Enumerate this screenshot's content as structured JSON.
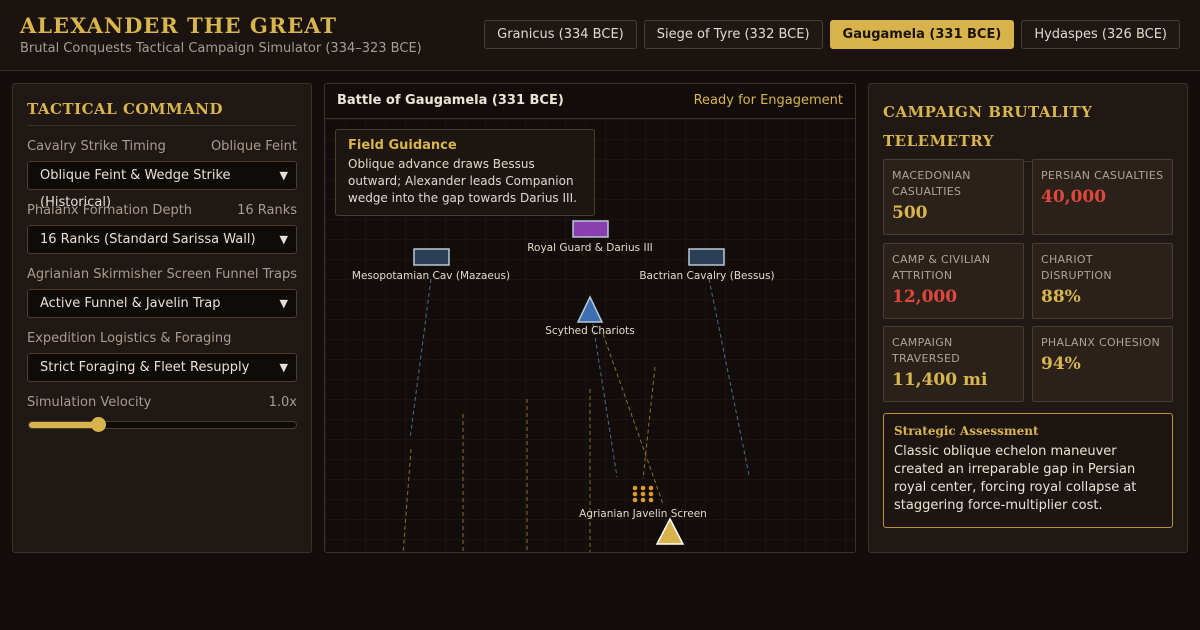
{
  "colors": {
    "accent": "#d9b54e",
    "danger": "#e0483c",
    "background": "#130e0b"
  },
  "header": {
    "title": "ALEXANDER THE GREAT",
    "subtitle": "Brutal Conquests Tactical Campaign Simulator (334–323 BCE)",
    "tabs": [
      {
        "label": "Granicus (334 BCE)",
        "active": false
      },
      {
        "label": "Siege of Tyre (332 BCE)",
        "active": false
      },
      {
        "label": "Gaugamela (331 BCE)",
        "active": true
      },
      {
        "label": "Hydaspes (326 BCE)",
        "active": false
      }
    ]
  },
  "command": {
    "title": "TACTICAL COMMAND",
    "controls": [
      {
        "label": "Cavalry Strike Timing",
        "value": "Oblique Feint",
        "selected": "Oblique Feint & Wedge Strike (Historical)"
      },
      {
        "label": "Phalanx Formation Depth",
        "value": "16 Ranks",
        "selected": "16 Ranks (Standard Sarissa Wall)"
      },
      {
        "label": "Agrianian Skirmisher Screen",
        "value": "Funnel Traps",
        "selected": "Active Funnel & Javelin Trap"
      },
      {
        "label": "Expedition Logistics & Foraging",
        "value": "",
        "selected": "Strict Foraging & Fleet Resupply"
      }
    ],
    "velocity": {
      "label": "Simulation Velocity",
      "value": "1.0x",
      "level": 0.26
    }
  },
  "battle": {
    "title": "Battle of Gaugamela (331 BCE)",
    "status": "Ready for Engagement",
    "guidance_title": "Field Guidance",
    "guidance_text": "Oblique advance draws Bessus outward; Alexander leads Companion wedge into the gap towards Darius III.",
    "units": {
      "royal_guard": "Royal Guard & Darius III",
      "mesopotamian": "Mesopotamian Cav (Mazaeus)",
      "bactrian": "Bactrian Cavalry (Bessus)",
      "chariots": "Scythed Chariots",
      "agrianian": "Agrianian Javelin Screen"
    }
  },
  "telemetry": {
    "title": "CAMPAIGN BRUTALITY TELEMETRY",
    "stats": [
      {
        "label": "MACEDONIAN CASUALTIES",
        "value": "500",
        "color": "#d9b54e"
      },
      {
        "label": "PERSIAN CASUALTIES",
        "value": "40,000",
        "color": "#e0483c"
      },
      {
        "label": "CAMP & CIVILIAN ATTRITION",
        "value": "12,000",
        "color": "#e0483c"
      },
      {
        "label": "CHARIOT DISRUPTION",
        "value": "88%",
        "color": "#d9b54e"
      },
      {
        "label": "CAMPAIGN TRAVERSED",
        "value": "11,400 mi",
        "color": "#d9b54e"
      },
      {
        "label": "PHALANX COHESION",
        "value": "94%",
        "color": "#d9b54e"
      }
    ],
    "assessment_title": "Strategic Assessment",
    "assessment_text": "Classic oblique echelon maneuver created an irreparable gap in Persian royal center, forcing royal collapse at staggering force-multiplier cost."
  }
}
